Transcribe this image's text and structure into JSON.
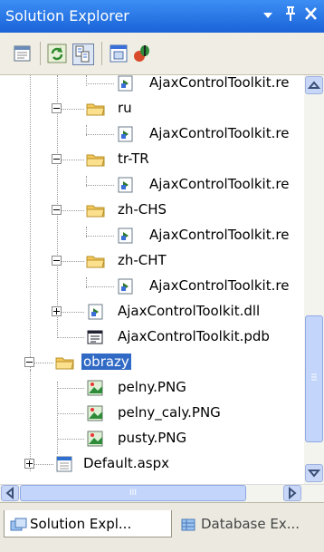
{
  "window": {
    "title": "Solution Explorer"
  },
  "toolbar": {
    "buttons": [
      "properties-icon",
      "refresh-icon",
      "show-all-files-icon",
      "view-code-icon",
      "class-diagram-icon"
    ]
  },
  "tree": {
    "rows": [
      {
        "label": "AjaxControlToolkit.re",
        "type": "resource",
        "depth": 3
      },
      {
        "label": "ru",
        "type": "folder",
        "expanded": true,
        "depth": 2
      },
      {
        "label": "AjaxControlToolkit.re",
        "type": "resource",
        "depth": 3
      },
      {
        "label": "tr-TR",
        "type": "folder",
        "expanded": true,
        "depth": 2
      },
      {
        "label": "AjaxControlToolkit.re",
        "type": "resource",
        "depth": 3
      },
      {
        "label": "zh-CHS",
        "type": "folder",
        "expanded": true,
        "depth": 2
      },
      {
        "label": "AjaxControlToolkit.re",
        "type": "resource",
        "depth": 3
      },
      {
        "label": "zh-CHT",
        "type": "folder",
        "expanded": true,
        "depth": 2
      },
      {
        "label": "AjaxControlToolkit.re",
        "type": "resource",
        "depth": 3
      },
      {
        "label": "AjaxControlToolkit.dll",
        "type": "dll",
        "expanded": false,
        "depth": 2
      },
      {
        "label": "AjaxControlToolkit.pdb",
        "type": "pdb",
        "depth": 2
      },
      {
        "label": "obrazy",
        "type": "folder",
        "expanded": true,
        "selected": true,
        "depth": 1
      },
      {
        "label": "pelny.PNG",
        "type": "image",
        "depth": 2
      },
      {
        "label": "pelny_caly.PNG",
        "type": "image",
        "depth": 2
      },
      {
        "label": "pusty.PNG",
        "type": "image",
        "depth": 2
      },
      {
        "label": "Default.aspx",
        "type": "aspx",
        "expanded": false,
        "depth": 1
      }
    ]
  },
  "scrollbar": {
    "hscroll_grip": "III"
  },
  "tabs": [
    {
      "label": "Solution Expl...",
      "active": true
    },
    {
      "label": "Database Ex...",
      "active": false
    }
  ],
  "colors": {
    "title_bar": "#2a78ea",
    "selection": "#316ac5",
    "folder": "#f4c85a"
  }
}
